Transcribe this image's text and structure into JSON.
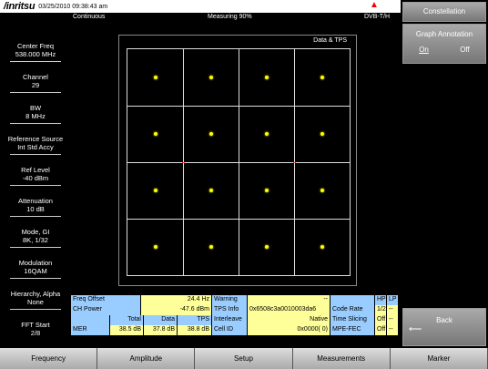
{
  "header": {
    "brand": "/inritsu",
    "timestamp": "03/25/2010 09:38:43 am"
  },
  "status": {
    "mode": "Continuous",
    "measuring": "Measuring  90%",
    "standard": "DVB-T/H"
  },
  "left_params": [
    {
      "label": "Center Freq",
      "value": "538.000 MHz"
    },
    {
      "label": "Channel",
      "value": "29"
    },
    {
      "label": "BW",
      "value": "8 MHz"
    },
    {
      "label": "Reference Source",
      "value": "Int Std Accy"
    },
    {
      "label": "Ref Level",
      "value": "-40 dBm"
    },
    {
      "label": "Attenuation",
      "value": "10 dB"
    },
    {
      "label": "Mode, GI",
      "value": "8K, 1/32"
    },
    {
      "label": "Modulation",
      "value": "16QAM"
    },
    {
      "label": "Hierarchy, Alpha",
      "value": "None"
    },
    {
      "label": "FFT Start",
      "value": "2/8"
    }
  ],
  "graph": {
    "title": "Data & TPS"
  },
  "constellation_levels": [
    -3,
    -1,
    1,
    3
  ],
  "table": {
    "freq_offset_label": "Freq Offset",
    "freq_offset": "24.4 Hz",
    "warning_label": "Warning",
    "warning": "--",
    "hp_label": "HP",
    "lp_label": "LP",
    "ch_power_label": "CH Power",
    "ch_power": "-47.6 dBm",
    "tps_info_label": "TPS Info",
    "tps_info": "0x6508c3a0010003da6",
    "code_rate_label": "Code Rate",
    "code_rate_hp": "1/2",
    "code_rate_lp": "--",
    "total_label": "Total",
    "data_label": "Data",
    "tps_label": "TPS",
    "interleave_label": "Interleave",
    "interleave": "Native",
    "time_slicing_label": "Time Slicing",
    "time_slicing_hp": "Off",
    "time_slicing_lp": "--",
    "mer_label": "MER",
    "mer_total": "38.5 dB",
    "mer_data": "37.8 dB",
    "mer_tps": "38.8 dB",
    "cell_id_label": "Cell ID",
    "cell_id": "0x0000(    0)",
    "mpe_fec_label": "MPE-FEC",
    "mpe_fec_hp": "Off",
    "mpe_fec_lp": "--"
  },
  "right_menu": {
    "title": "Constellation",
    "graph_annotation": "Graph Annotation",
    "on": "On",
    "off": "Off",
    "back": "Back",
    "back_arrow": "⟵"
  },
  "bottom_menu": [
    "Frequency",
    "Amplitude",
    "Setup",
    "Measurements",
    "Marker"
  ]
}
